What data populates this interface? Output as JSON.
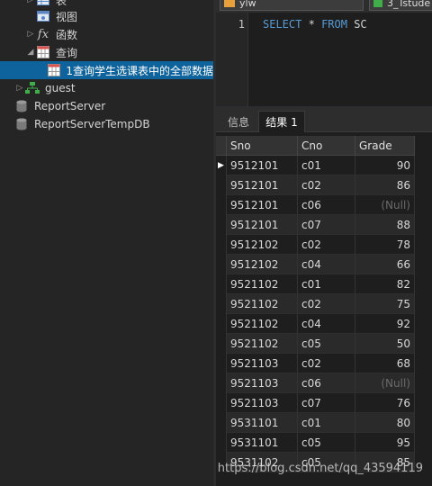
{
  "tree": {
    "items": [
      {
        "label": "表",
        "icon": "table-folder-icon"
      },
      {
        "label": "视图",
        "icon": "view-folder-icon"
      },
      {
        "label": "函数",
        "icon": "function-icon"
      },
      {
        "label": "查询",
        "icon": "query-folder-icon"
      },
      {
        "label": "1查询学生选课表中的全部数据",
        "icon": "query-icon"
      },
      {
        "label": "guest",
        "icon": "schema-icon"
      },
      {
        "label": "ReportServer",
        "icon": "database-icon"
      },
      {
        "label": "ReportServerTempDB",
        "icon": "database-icon"
      }
    ]
  },
  "toolbar": {
    "connection": "ylw",
    "database": "3_Tstude"
  },
  "editor": {
    "line_number": "1",
    "code_keyword1": "SELECT",
    "code_star": "*",
    "code_keyword2": "FROM",
    "code_table": "SC"
  },
  "tabs": [
    {
      "label": "信息"
    },
    {
      "label": "结果 1"
    }
  ],
  "result": {
    "columns": [
      "Sno",
      "Cno",
      "Grade"
    ],
    "rows": [
      [
        "9512101",
        "c01",
        "90"
      ],
      [
        "9512101",
        "c02",
        "86"
      ],
      [
        "9512101",
        "c06",
        "(Null)"
      ],
      [
        "9512101",
        "c07",
        "88"
      ],
      [
        "9512102",
        "c02",
        "78"
      ],
      [
        "9512102",
        "c04",
        "66"
      ],
      [
        "9521102",
        "c01",
        "82"
      ],
      [
        "9521102",
        "c02",
        "75"
      ],
      [
        "9521102",
        "c04",
        "92"
      ],
      [
        "9521102",
        "c05",
        "50"
      ],
      [
        "9521103",
        "c02",
        "68"
      ],
      [
        "9521103",
        "c06",
        "(Null)"
      ],
      [
        "9521103",
        "c07",
        "76"
      ],
      [
        "9531101",
        "c01",
        "80"
      ],
      [
        "9531101",
        "c05",
        "95"
      ],
      [
        "9531102",
        "c05",
        "85"
      ]
    ]
  },
  "watermark": "https://blog.csdn.net/qq_43594119",
  "colors": {
    "selection": "#0e639c",
    "keyword": "#569cd6",
    "null_text": "#6a6a6a"
  }
}
